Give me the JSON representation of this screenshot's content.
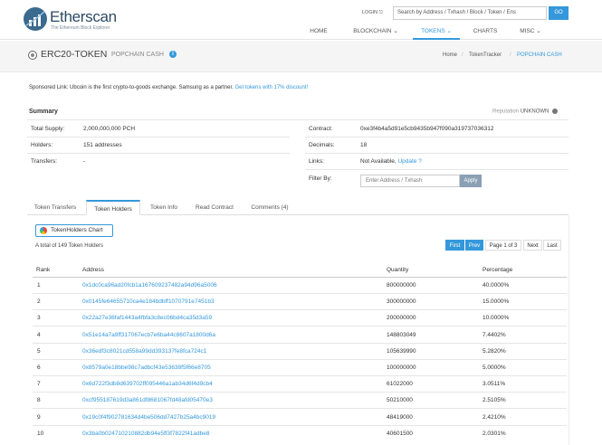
{
  "header": {
    "logo_text": "Etherscan",
    "logo_sub": "The Ethereum Block Explorer",
    "login": "LOGIN",
    "search_placeholder": "Search by Address / Txhash / Block / Token / Ens",
    "go": "GO",
    "nav": [
      "HOME",
      "BLOCKCHAIN",
      "TOKENS",
      "CHARTS",
      "MISC"
    ]
  },
  "title_bar": {
    "title": "ERC20-TOKEN",
    "token_name": "POPCHAIN CASH",
    "breadcrumb": [
      "Home",
      "TokenTracker",
      "POPCHAIN CASH"
    ]
  },
  "sponsored": {
    "label": "Sponsored Link:",
    "text": "Ubcoin is the first crypto-to-goods exchange. Samsung as a partner.",
    "link": "Get tokens with 17% discount!"
  },
  "summary": {
    "title": "Summary",
    "reputation_label": "Reputation",
    "reputation_value": "UNKNOWN",
    "total_supply_label": "Total Supply:",
    "total_supply_value": "2,000,000,000 PCH",
    "holders_label": "Holders:",
    "holders_value": "151 addresses",
    "transfers_label": "Transfers:",
    "transfers_value": "-",
    "contract_label": "Contract:",
    "contract_value": "0xe3f4b4a5d91e5cb9435b947f090a319737036312",
    "decimals_label": "Decimals:",
    "decimals_value": "18",
    "links_label": "Links:",
    "links_value": "Not Available,",
    "links_update": "Update ?",
    "filter_label": "Filter By:",
    "filter_placeholder": "Enter Address / Txhash",
    "apply": "Apply"
  },
  "tabs": [
    "Token Transfers",
    "Token Holders",
    "Token Info",
    "Read Contract",
    "Comments (4)"
  ],
  "holders": {
    "chart_button": "TokenHolders Chart",
    "total_text": "A total of 149 Token Holders",
    "pagination": [
      "First",
      "Prev",
      "Page 1 of 3",
      "Next",
      "Last"
    ],
    "columns": [
      "Rank",
      "Address",
      "Quantity",
      "Percentage"
    ],
    "rows": [
      {
        "rank": "1",
        "address": "0x1dc0ca96ad20fcb1a167609237482a94d96a5006",
        "quantity": "800000000",
        "percentage": "40.0000%"
      },
      {
        "rank": "2",
        "address": "0x0145fe64655710ca4e184bdbff1070791e7451b3",
        "quantity": "300000000",
        "percentage": "15.0000%"
      },
      {
        "rank": "3",
        "address": "0x22a27e36faf1443a4fbfa3c8ec06bd4ca35d3a59",
        "quantity": "200000000",
        "percentage": "10.0000%"
      },
      {
        "rank": "4",
        "address": "0x51e14a7a9ff317067ecb7e6ba44c8607a1800d6a",
        "quantity": "148803049",
        "percentage": "7.4402%"
      },
      {
        "rank": "5",
        "address": "0x36edf3c8021cd558a99dd393137fe8fca724c1",
        "quantity": "105639990",
        "percentage": "5.2820%"
      },
      {
        "rank": "6",
        "address": "0x8579a0e18bbe98c7adbcf43e53638f5f66e8705",
        "quantity": "100000000",
        "percentage": "5.0000%"
      },
      {
        "rank": "7",
        "address": "0x6d722f3db8d639702ff095446a1ab34d6f4d9cb4",
        "quantity": "61022000",
        "percentage": "3.0511%"
      },
      {
        "rank": "8",
        "address": "0xcf955187619d3a861df8681067fd48afd05470e3",
        "quantity": "50210000",
        "percentage": "2.5105%"
      },
      {
        "rank": "9",
        "address": "0x19c0f4f902781634d4be506dd7427b25a4bc9019",
        "quantity": "48419000",
        "percentage": "2.4210%"
      },
      {
        "rank": "10",
        "address": "0x3ba0b024710210882db94e5ff3f7822f41adbe8",
        "quantity": "40601500",
        "percentage": "2.0301%"
      }
    ]
  }
}
